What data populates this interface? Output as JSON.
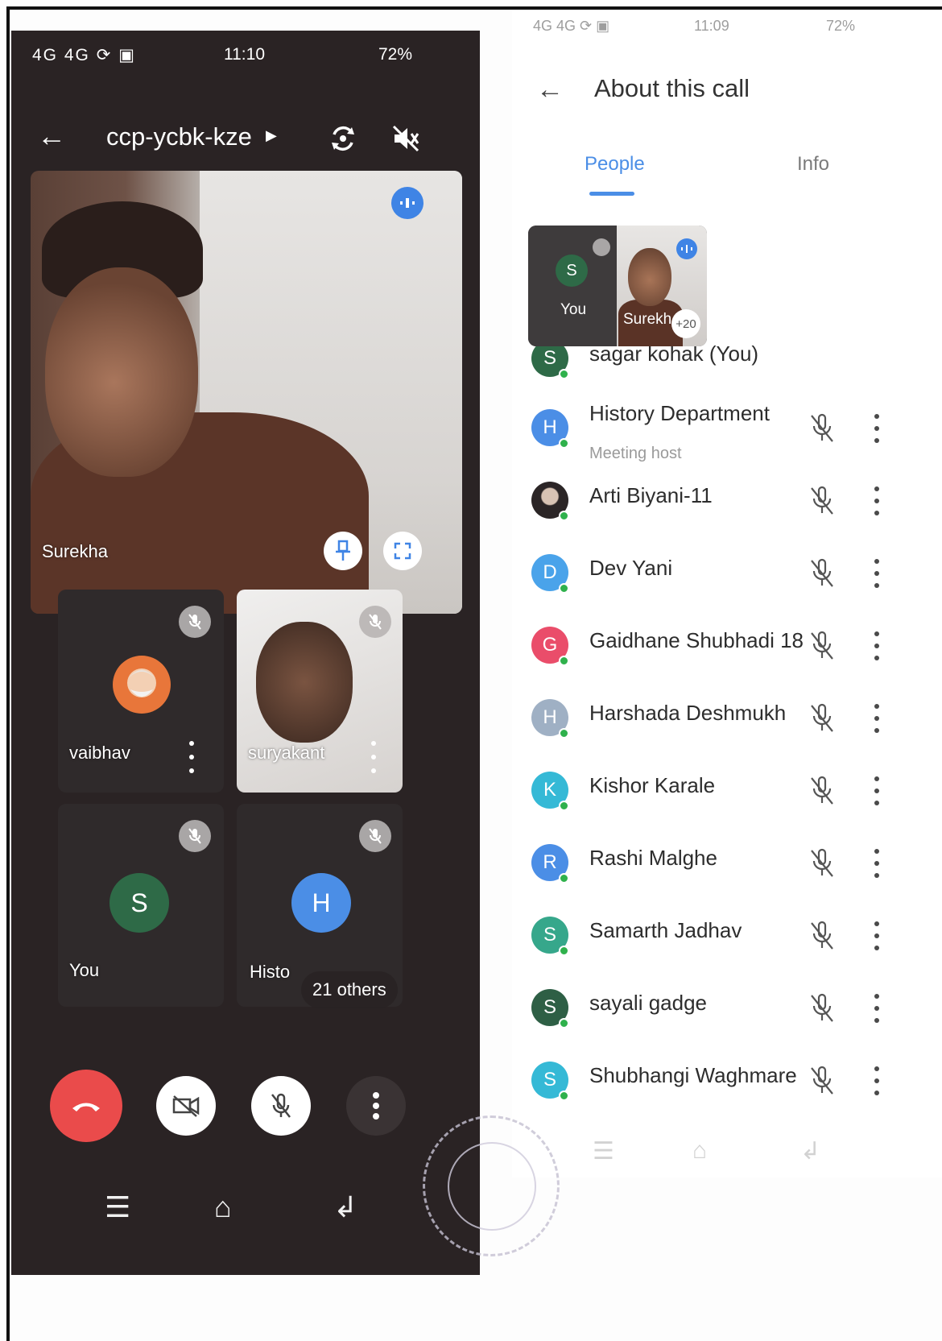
{
  "left_phone": {
    "status": {
      "signal": "4G 4G ⟳ ▣",
      "time": "11:10",
      "battery": "72%"
    },
    "meeting_code": "ccp-ycbk-kze",
    "main_speaker_name": "Surekha",
    "tiles": [
      {
        "name": "vaibhav"
      },
      {
        "name": "suryakant"
      },
      {
        "name": "You",
        "initial": "S",
        "color": "#2e6a47"
      },
      {
        "name": "Histo",
        "initial": "H",
        "color": "#4b8ee6",
        "others_label": "21 others"
      }
    ]
  },
  "right_phone": {
    "status": {
      "signal": "4G 4G ⟳ ▣",
      "time": "11:09",
      "battery": "72%"
    },
    "title": "About this call",
    "tabs": [
      {
        "label": "People",
        "active": true
      },
      {
        "label": "Info",
        "active": false
      }
    ],
    "pip": {
      "you_label": "You",
      "you_initial": "S",
      "speaker_label": "Surekh",
      "extra_count": "+20"
    },
    "participants": [
      {
        "initial": "S",
        "name": "sagar kohak (You)",
        "color": "#2e6a47",
        "subtitle": ""
      },
      {
        "initial": "H",
        "name": "History Department",
        "color": "#4b8ee6",
        "subtitle": "Meeting host"
      },
      {
        "initial": "",
        "name": "Arti Biyani-11",
        "color": "#3a3a3a",
        "subtitle": ""
      },
      {
        "initial": "D",
        "name": "Dev Yani",
        "color": "#4aa3ea",
        "subtitle": ""
      },
      {
        "initial": "G",
        "name": "Gaidhane Shubhadi 18",
        "color": "#ea4d6a",
        "subtitle": ""
      },
      {
        "initial": "H",
        "name": "Harshada Deshmukh",
        "color": "#9fb0c4",
        "subtitle": ""
      },
      {
        "initial": "K",
        "name": "Kishor Karale",
        "color": "#35b9d6",
        "subtitle": ""
      },
      {
        "initial": "R",
        "name": "Rashi Malghe",
        "color": "#4b8ee6",
        "subtitle": ""
      },
      {
        "initial": "S",
        "name": "Samarth Jadhav",
        "color": "#36a78b",
        "subtitle": ""
      },
      {
        "initial": "S",
        "name": "sayali gadge",
        "color": "#2e5f45",
        "subtitle": ""
      },
      {
        "initial": "S",
        "name": "Shubhangi Waghmare",
        "color": "#35b9d6",
        "subtitle": ""
      }
    ]
  },
  "colors": {
    "accent": "#4b8ee6",
    "end_call": "#ea4b4b",
    "online": "#2fb14c"
  }
}
